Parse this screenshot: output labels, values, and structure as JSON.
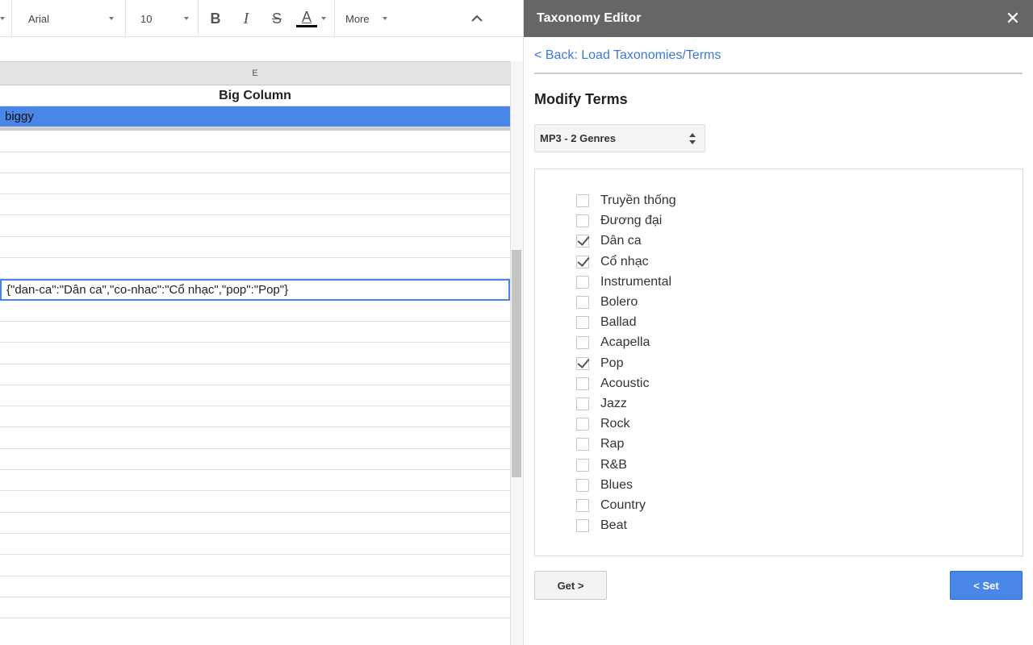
{
  "toolbar": {
    "font_name": "Arial",
    "font_size": "10",
    "bold_label": "B",
    "italic_label": "I",
    "strike_label": "S",
    "text_color_label": "A",
    "more_label": "More"
  },
  "sheet": {
    "column_letter": "E",
    "rows": [
      "Big Column",
      "biggy",
      "",
      "",
      "",
      "",
      "",
      "",
      "",
      "{\"dan-ca\":\"Dân ca\",\"co-nhac\":\"Cổ nhạc\",\"pop\":\"Pop\"}",
      "",
      "",
      "",
      "",
      "",
      "",
      "",
      "",
      "",
      "",
      "",
      "",
      "",
      "",
      "",
      ""
    ]
  },
  "sidebar": {
    "title": "Taxonomy Editor",
    "close_label": "✕",
    "back_link": "< Back: Load Taxonomies/Terms",
    "section_title": "Modify Terms",
    "taxonomy_selected": "MP3 - 2 Genres",
    "terms": [
      {
        "label": "Truyền thống",
        "checked": false
      },
      {
        "label": "Đương đại",
        "checked": false
      },
      {
        "label": "Dân ca",
        "checked": true
      },
      {
        "label": "Cổ nhạc",
        "checked": true
      },
      {
        "label": "Instrumental",
        "checked": false
      },
      {
        "label": "Bolero",
        "checked": false
      },
      {
        "label": "Ballad",
        "checked": false
      },
      {
        "label": "Acapella",
        "checked": false
      },
      {
        "label": "Pop",
        "checked": true
      },
      {
        "label": "Acoustic",
        "checked": false
      },
      {
        "label": "Jazz",
        "checked": false
      },
      {
        "label": "Rock",
        "checked": false
      },
      {
        "label": "Rap",
        "checked": false
      },
      {
        "label": "R&B",
        "checked": false
      },
      {
        "label": "Blues",
        "checked": false
      },
      {
        "label": "Country",
        "checked": false
      },
      {
        "label": "Beat",
        "checked": false
      }
    ],
    "get_label": "Get >",
    "set_label": "< Set"
  },
  "colors": {
    "accent": "#4a86e8",
    "header_bg": "#666666",
    "link": "#3c78d8"
  }
}
